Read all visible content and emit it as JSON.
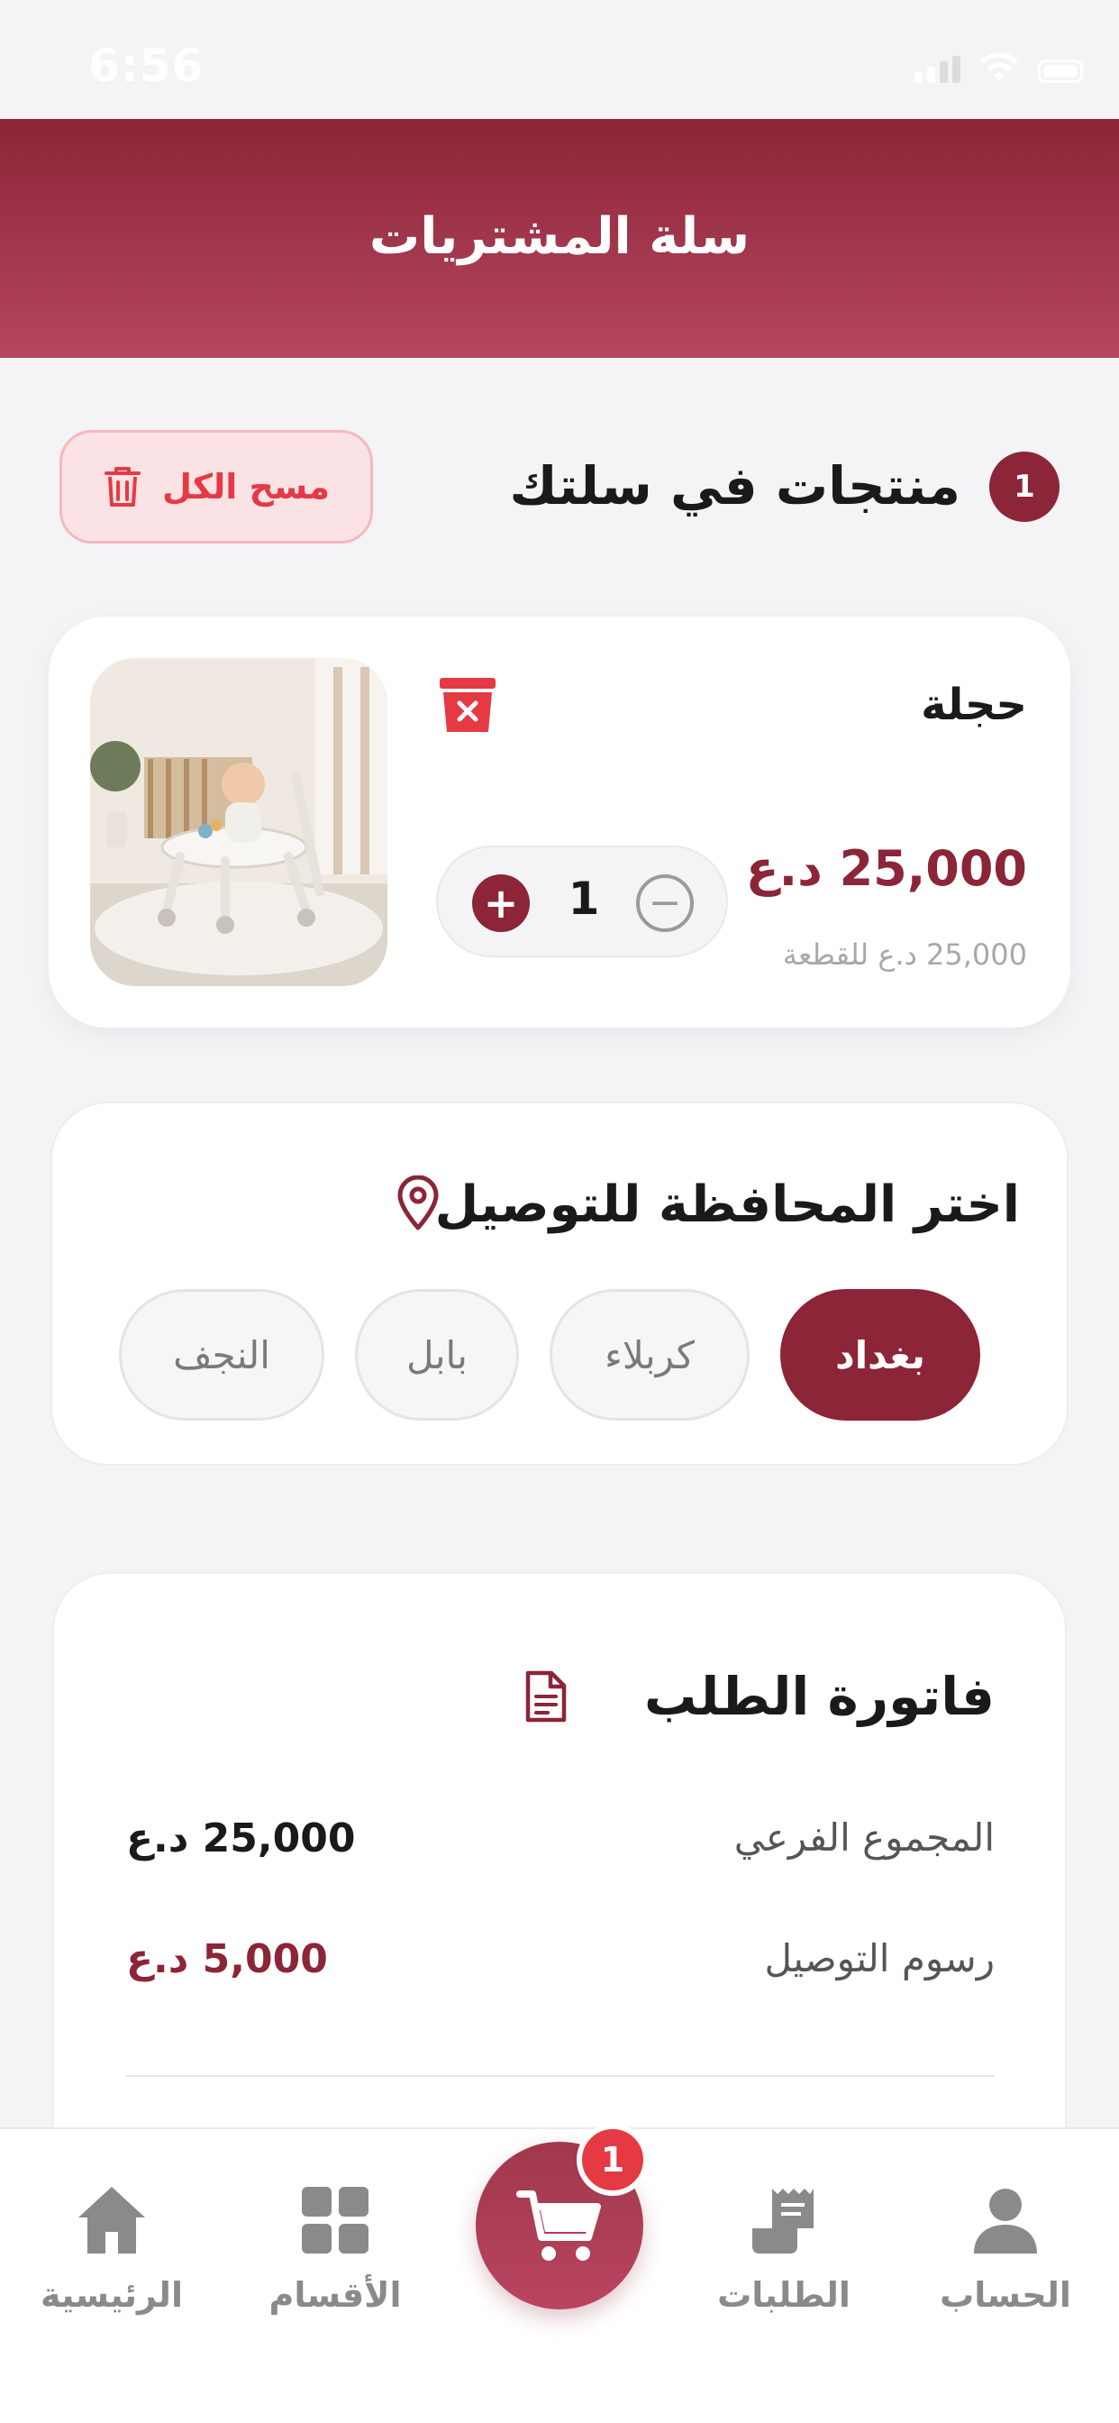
{
  "status_bar": {
    "time": "6:56"
  },
  "header": {
    "title": "سلة المشتريات"
  },
  "cart_summary": {
    "count": "1",
    "title": "منتجات في سلتك",
    "clear_label": "مسح الكل"
  },
  "product": {
    "name": "حجلة",
    "price": "25,000 د.ع",
    "unit_price": "25,000 د.ع للقطعة",
    "quantity": "1",
    "plus": "+",
    "minus": "−"
  },
  "delivery": {
    "title": "اختر المحافظة للتوصيل",
    "options": [
      "بغداد",
      "كربلاء",
      "بابل",
      "النجف"
    ],
    "selected": "بغداد"
  },
  "invoice": {
    "title": "فاتورة الطلب",
    "rows": [
      {
        "label": "المجموع الفرعي",
        "value": "25,000 د.ع"
      },
      {
        "label": "رسوم التوصيل",
        "value": "5,000 د.ع"
      }
    ]
  },
  "bottom_nav": {
    "items": [
      {
        "label": "الحساب",
        "icon": "user-icon"
      },
      {
        "label": "الطلبات",
        "icon": "orders-icon"
      },
      {
        "label": "",
        "icon": "cart-icon"
      },
      {
        "label": "الأقسام",
        "icon": "grid-icon"
      },
      {
        "label": "الرئيسية",
        "icon": "home-icon"
      }
    ],
    "cart_badge": "1"
  },
  "colors": {
    "brand": "#8c2537",
    "danger": "#e53944",
    "muted": "#8a8a8a"
  }
}
